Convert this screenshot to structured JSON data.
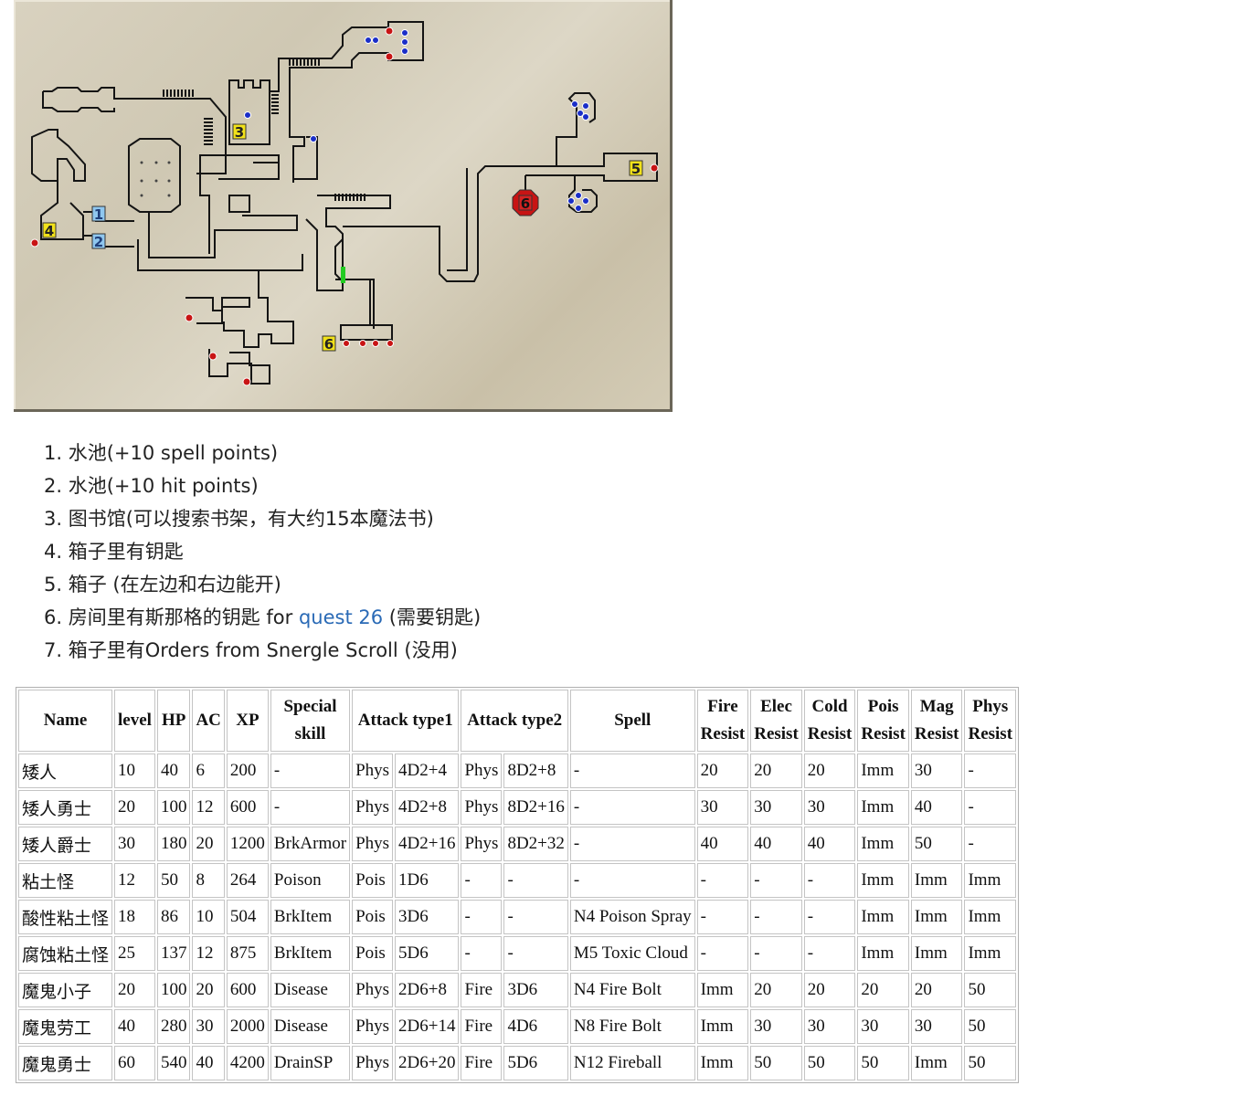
{
  "map": {
    "markers": [
      "1",
      "2",
      "3",
      "4",
      "5",
      "6",
      "6"
    ],
    "colors": {
      "red_dot": "#c81414",
      "blue_dot": "#1a2ec8",
      "marker_yellow": "#f2e21a",
      "marker_blue": "#8fc7ef",
      "marker_red": "#d42222",
      "door_green": "#22cc22"
    }
  },
  "notes": [
    {
      "n": "1. ",
      "text": "水池(+10 spell points)"
    },
    {
      "n": "2. ",
      "text": "水池(+10 hit points)"
    },
    {
      "n": "3. ",
      "text": "图书馆(可以搜索书架，有大约15本魔法书)"
    },
    {
      "n": "4. ",
      "text": "箱子里有钥匙"
    },
    {
      "n": "5. ",
      "text": "箱子 (在左边和右边能开)"
    },
    {
      "n": "6. ",
      "text": "房间里有斯那格的钥匙 for ",
      "link": "quest 26",
      "after": " (需要钥匙)"
    },
    {
      "n": "7. ",
      "text": "箱子里有Orders from Snergle Scroll (没用)"
    }
  ],
  "table": {
    "headers": [
      {
        "label": "Name",
        "span": 1
      },
      {
        "label": "level",
        "span": 1
      },
      {
        "label": "HP",
        "span": 1
      },
      {
        "label": "AC",
        "span": 1
      },
      {
        "label": "XP",
        "span": 1
      },
      {
        "label": "Special skill",
        "span": 1
      },
      {
        "label": "Attack type1",
        "span": 2
      },
      {
        "label": "Attack type2",
        "span": 2
      },
      {
        "label": "Spell",
        "span": 1
      },
      {
        "label": "Fire Resist",
        "span": 1
      },
      {
        "label": "Elec Resist",
        "span": 1
      },
      {
        "label": "Cold Resist",
        "span": 1
      },
      {
        "label": "Pois Resist",
        "span": 1
      },
      {
        "label": "Mag Resist",
        "span": 1
      },
      {
        "label": "Phys Resist",
        "span": 1
      }
    ],
    "rows": [
      [
        "矮人",
        "10",
        "40",
        "6",
        "200",
        "-",
        "Phys",
        "4D2+4",
        "Phys",
        "8D2+8",
        "-",
        "20",
        "20",
        "20",
        "Imm",
        "30",
        "-"
      ],
      [
        "矮人勇士",
        "20",
        "100",
        "12",
        "600",
        "-",
        "Phys",
        "4D2+8",
        "Phys",
        "8D2+16",
        "-",
        "30",
        "30",
        "30",
        "Imm",
        "40",
        "-"
      ],
      [
        "矮人爵士",
        "30",
        "180",
        "20",
        "1200",
        "BrkArmor",
        "Phys",
        "4D2+16",
        "Phys",
        "8D2+32",
        "-",
        "40",
        "40",
        "40",
        "Imm",
        "50",
        "-"
      ],
      [
        "粘土怪",
        "12",
        "50",
        "8",
        "264",
        "Poison",
        "Pois",
        "1D6",
        "-",
        "-",
        "-",
        "-",
        "-",
        "-",
        "Imm",
        "Imm",
        "Imm"
      ],
      [
        "酸性粘土怪",
        "18",
        "86",
        "10",
        "504",
        "BrkItem",
        "Pois",
        "3D6",
        "-",
        "-",
        "N4 Poison Spray",
        "-",
        "-",
        "-",
        "Imm",
        "Imm",
        "Imm"
      ],
      [
        "腐蚀粘土怪",
        "25",
        "137",
        "12",
        "875",
        "BrkItem",
        "Pois",
        "5D6",
        "-",
        "-",
        "M5 Toxic Cloud",
        "-",
        "-",
        "-",
        "Imm",
        "Imm",
        "Imm"
      ],
      [
        "魔鬼小子",
        "20",
        "100",
        "20",
        "600",
        "Disease",
        "Phys",
        "2D6+8",
        "Fire",
        "3D6",
        "N4 Fire Bolt",
        "Imm",
        "20",
        "20",
        "20",
        "20",
        "50"
      ],
      [
        "魔鬼劳工",
        "40",
        "280",
        "30",
        "2000",
        "Disease",
        "Phys",
        "2D6+14",
        "Fire",
        "4D6",
        "N8 Fire Bolt",
        "Imm",
        "30",
        "30",
        "30",
        "30",
        "50"
      ],
      [
        "魔鬼勇士",
        "60",
        "540",
        "40",
        "4200",
        "DrainSP",
        "Phys",
        "2D6+20",
        "Fire",
        "5D6",
        "N12 Fireball",
        "Imm",
        "50",
        "50",
        "50",
        "Imm",
        "50"
      ]
    ]
  }
}
